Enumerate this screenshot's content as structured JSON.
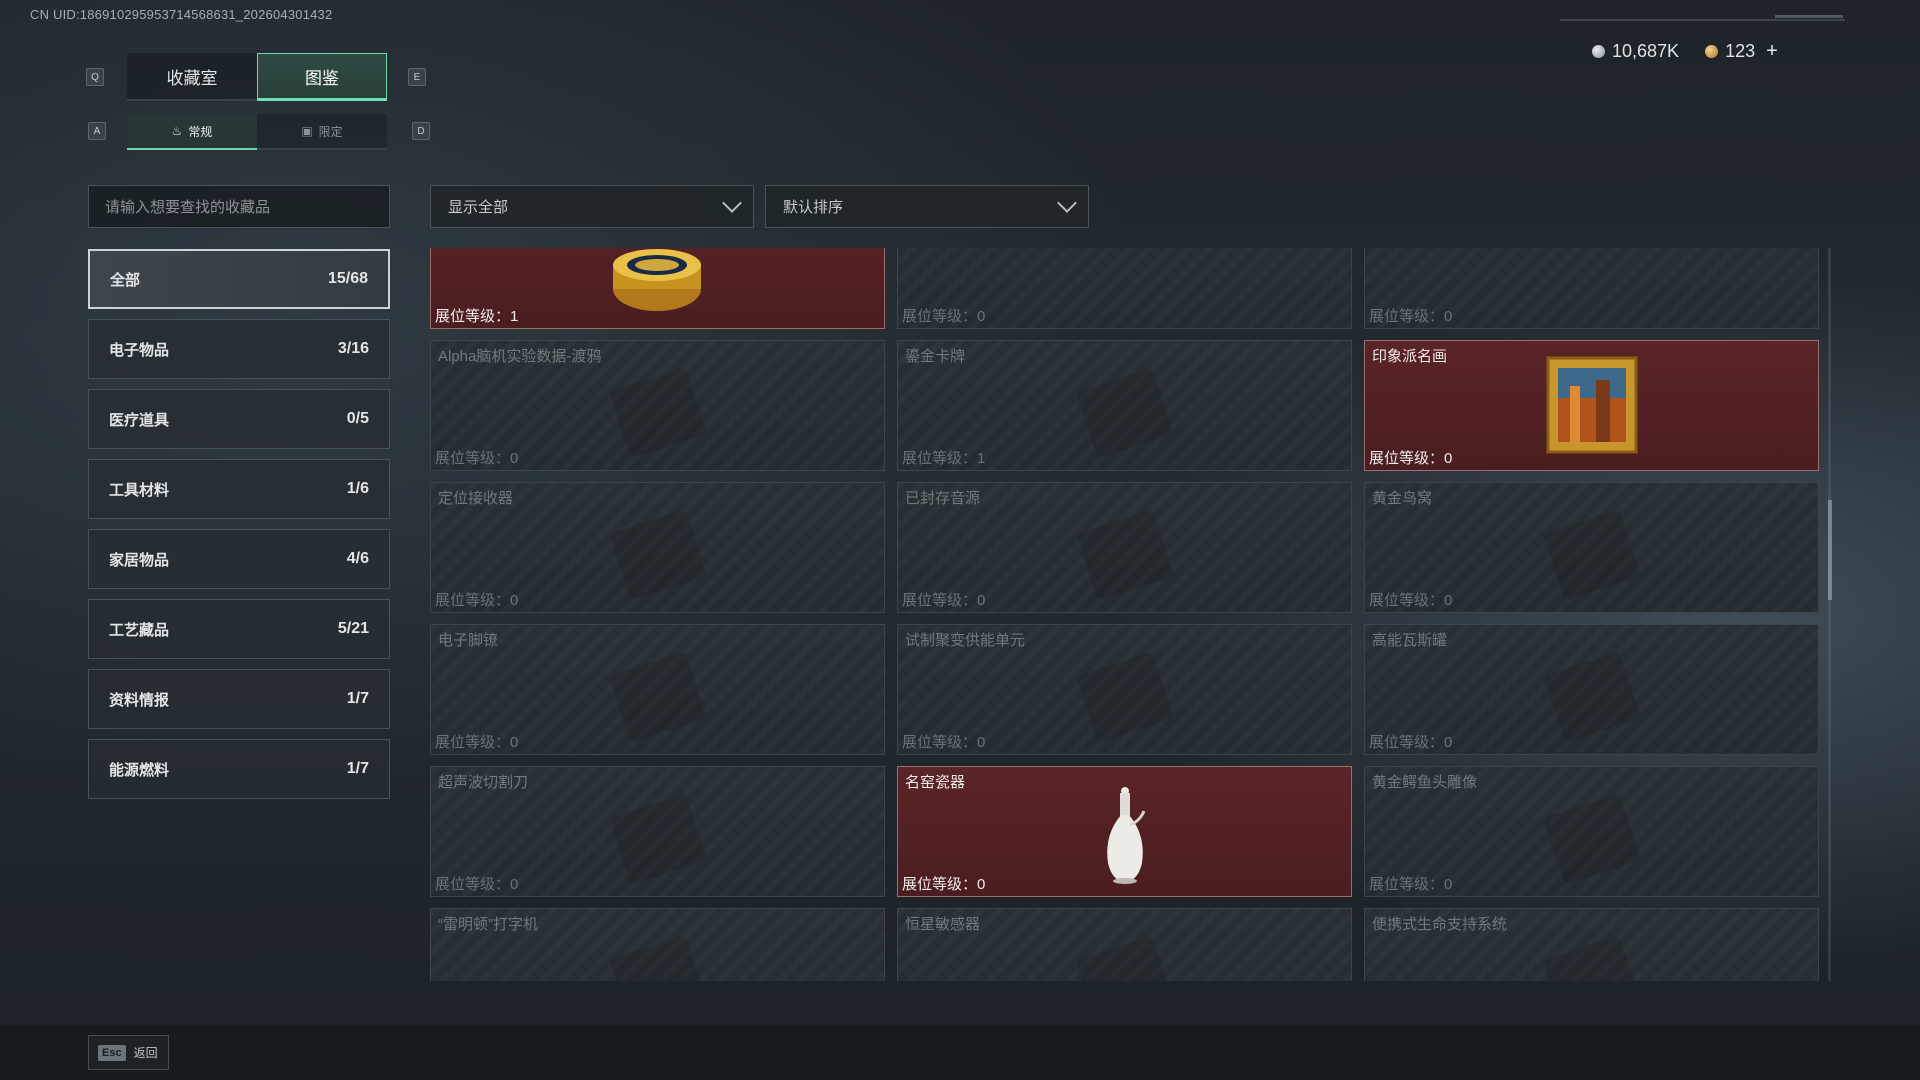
{
  "uid_text": "CN UID:18691029595371456863​1_202604301432",
  "currency": {
    "silver": "10,687K",
    "gold": "123",
    "add": "+"
  },
  "keys": {
    "q": "Q",
    "e": "E",
    "a": "A",
    "d": "D"
  },
  "tabs": [
    {
      "label": "收藏室"
    },
    {
      "label": "图鉴"
    }
  ],
  "subtabs": [
    {
      "label": "常规"
    },
    {
      "label": "限定"
    }
  ],
  "search": {
    "placeholder": "请输入想要查找的收藏品"
  },
  "filters": {
    "show": "显示全部",
    "sort": "默认排序"
  },
  "categories": [
    {
      "label": "全部",
      "count": "15/68"
    },
    {
      "label": "电子物品",
      "count": "3/16"
    },
    {
      "label": "医疗道具",
      "count": "0/5"
    },
    {
      "label": "工具材料",
      "count": "1/6"
    },
    {
      "label": "家居物品",
      "count": "4/6"
    },
    {
      "label": "工艺藏品",
      "count": "5/21"
    },
    {
      "label": "资料情报",
      "count": "1/7"
    },
    {
      "label": "能源燃料",
      "count": "1/7"
    }
  ],
  "level_prefix": "展位等级：",
  "cards": [
    {
      "name": "",
      "level": "1"
    },
    {
      "name": "",
      "level": "0"
    },
    {
      "name": "",
      "level": "0"
    },
    {
      "name": "Alpha脑机实验数据-渡鸦",
      "level": "0"
    },
    {
      "name": "鎏金卡牌",
      "level": "1"
    },
    {
      "name": "印象派名画",
      "level": "0"
    },
    {
      "name": "定位接收器",
      "level": "0"
    },
    {
      "name": "已封存音源",
      "level": "0"
    },
    {
      "name": "黄金鸟窝",
      "level": "0"
    },
    {
      "name": "电子脚镣",
      "level": "0"
    },
    {
      "name": "试制聚变供能单元",
      "level": "0"
    },
    {
      "name": "高能瓦斯罐",
      "level": "0"
    },
    {
      "name": "超声波切割刀",
      "level": "0"
    },
    {
      "name": "名窑瓷器",
      "level": "0"
    },
    {
      "name": "黄金鳄鱼头雕像",
      "level": "0"
    },
    {
      "name": "“雷明顿”打字机",
      "level": ""
    },
    {
      "name": "恒星敏感器",
      "level": ""
    },
    {
      "name": "便携式生命支持系统",
      "level": ""
    }
  ],
  "esc": {
    "key": "Esc",
    "label": "返回"
  }
}
